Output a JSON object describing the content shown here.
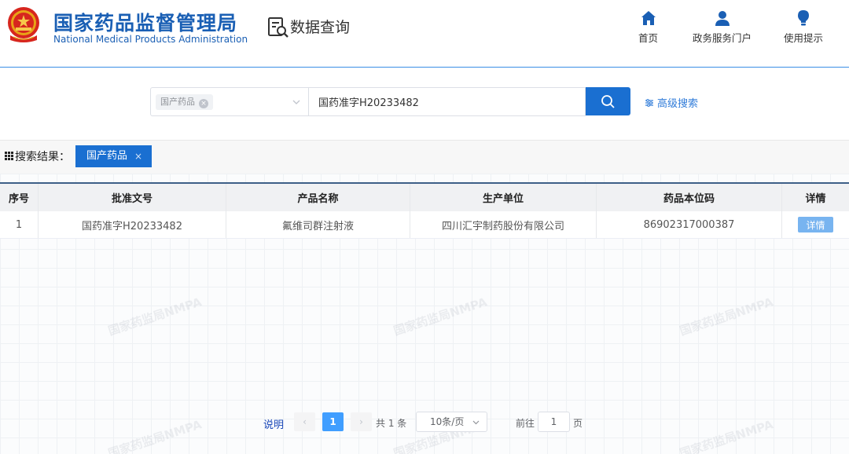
{
  "header": {
    "org_name_cn": "国家药品监督管理局",
    "org_name_en": "National Medical Products Administration",
    "section_title": "数据查询",
    "nav": [
      {
        "label": "首页",
        "icon": "home-icon"
      },
      {
        "label": "政务服务门户",
        "icon": "user-icon"
      },
      {
        "label": "使用提示",
        "icon": "lightbulb-icon"
      }
    ]
  },
  "search": {
    "category_tag": "国产药品",
    "query_value": "国药准字H20233482",
    "advanced_label": "高级搜索"
  },
  "results": {
    "label": "搜索结果：",
    "active_filter": "国产药品",
    "filter_close": "×"
  },
  "table": {
    "columns": [
      "序号",
      "批准文号",
      "产品名称",
      "生产单位",
      "药品本位码",
      "详情"
    ],
    "rows": [
      {
        "index": "1",
        "approval": "国药准字H20233482",
        "product": "氟维司群注射液",
        "manufacturer": "四川汇宇制药股份有限公司",
        "code": "86902317000387",
        "detail": "详情"
      }
    ]
  },
  "watermark": "国家药监局NMPA",
  "pagination": {
    "explain": "说明",
    "prev": "‹",
    "current": "1",
    "next": "›",
    "total": "共 1 条",
    "page_size": "10条/页",
    "goto_label": "前往",
    "goto_value": "1",
    "goto_unit": "页"
  },
  "colors": {
    "brand_blue": "#1a5fb4",
    "button_blue": "#1a6fd1",
    "detail_button": "#78b4f0",
    "active_page": "#409eff"
  }
}
